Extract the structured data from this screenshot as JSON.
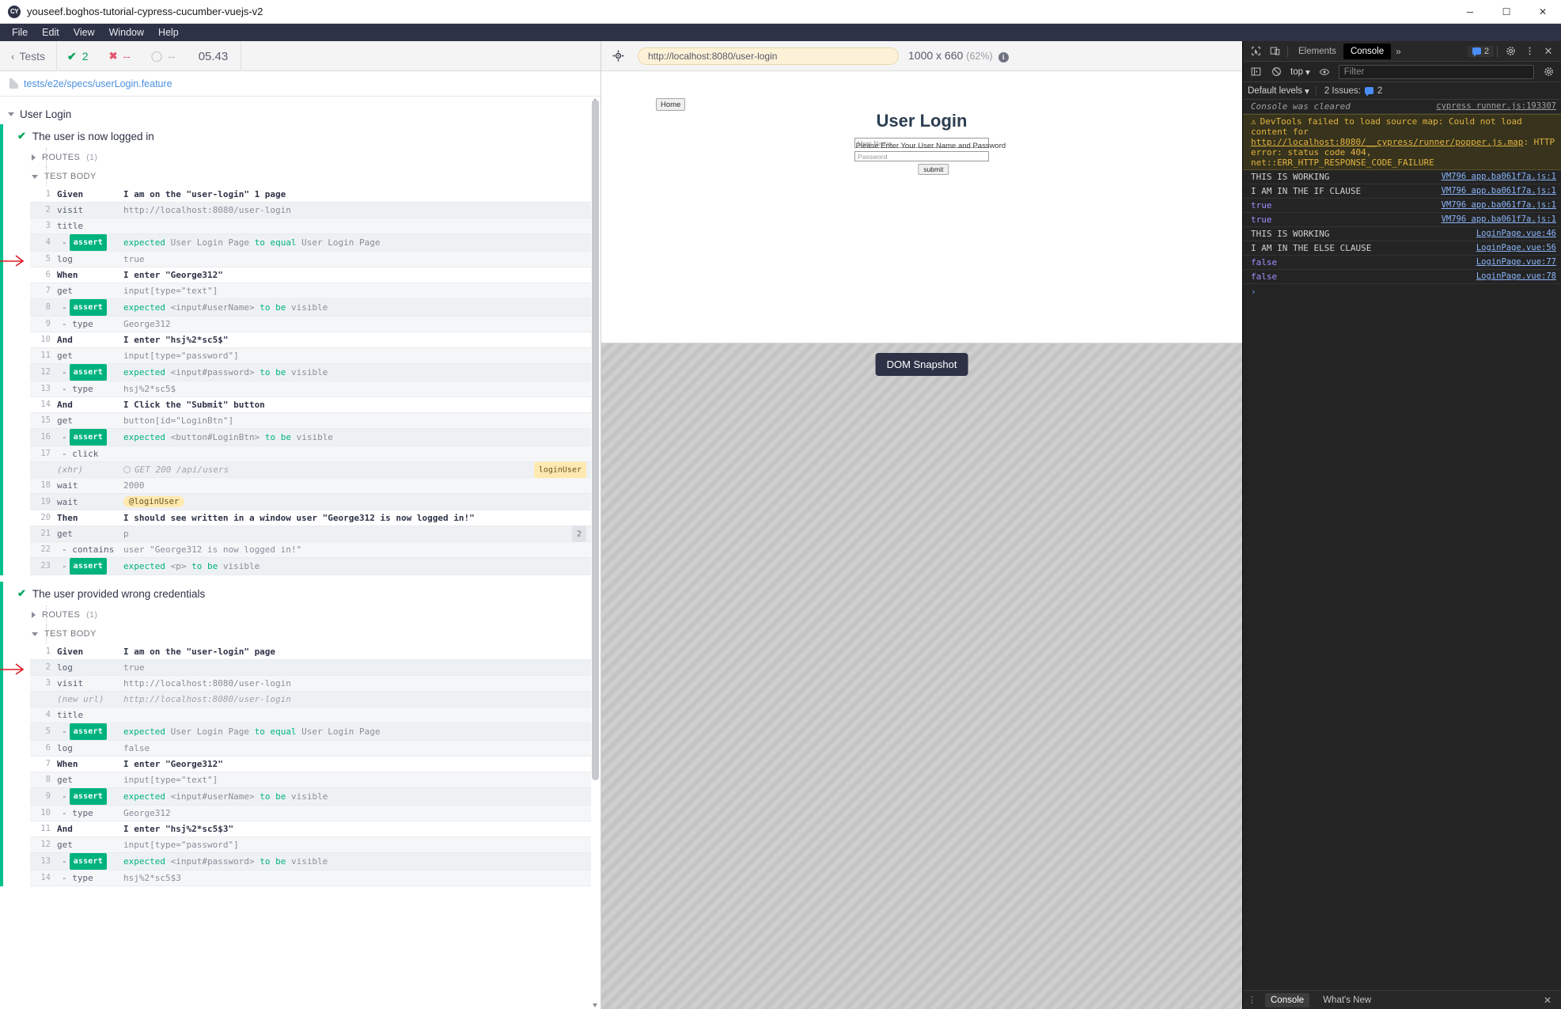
{
  "window": {
    "title": "youseef.boghos-tutorial-cypress-cucumber-vuejs-v2",
    "logo_text": "CY",
    "minimize": "─",
    "maximize": "☐",
    "close": "✕"
  },
  "menubar": {
    "items": [
      "File",
      "Edit",
      "View",
      "Window",
      "Help"
    ]
  },
  "reporter": {
    "back_label": "Tests",
    "back_chevron": "‹",
    "stats": {
      "passed_icon": "✔",
      "passed": "2",
      "failed_icon": "✖",
      "failed": "--",
      "pending_icon": "◯",
      "pending": "--"
    },
    "timer": "05.43",
    "restart_icon": "reload-icon",
    "spec_path": "tests/e2e/specs/userLogin.feature",
    "suite_title": "User Login",
    "tests": [
      {
        "name": "The user is now logged in",
        "routes_label": "ROUTES",
        "routes_count": "(1)",
        "test_body_label": "TEST BODY",
        "commands": [
          {
            "num": "1",
            "method": "Given",
            "message": "I am on the \"user-login\" 1 page",
            "type": "gherkin"
          },
          {
            "num": "2",
            "method": "visit",
            "message": "http://localhost:8080/user-login",
            "type": "normal"
          },
          {
            "num": "3",
            "method": "title",
            "message": "",
            "type": "normal"
          },
          {
            "num": "4",
            "method": "assert",
            "message": "expected User Login Page to equal User Login Page",
            "type": "assert",
            "child": true
          },
          {
            "num": "5",
            "method": "log",
            "message": "true",
            "type": "normal",
            "arrow": true
          },
          {
            "num": "6",
            "method": "When",
            "message": "I enter \"George312\"",
            "type": "gherkin"
          },
          {
            "num": "7",
            "method": "get",
            "message": "input[type=\"text\"]",
            "type": "normal"
          },
          {
            "num": "8",
            "method": "assert",
            "message": "expected <input#userName> to be visible",
            "type": "assert",
            "child": true
          },
          {
            "num": "9",
            "method": "type",
            "message": "George312",
            "type": "normal",
            "child": true
          },
          {
            "num": "10",
            "method": "And",
            "message": "I enter \"hsj%2*sc5$\"",
            "type": "gherkin"
          },
          {
            "num": "11",
            "method": "get",
            "message": "input[type=\"password\"]",
            "type": "normal"
          },
          {
            "num": "12",
            "method": "assert",
            "message": "expected <input#password> to be visible",
            "type": "assert",
            "child": true
          },
          {
            "num": "13",
            "method": "type",
            "message": "hsj%2*sc5$",
            "type": "normal",
            "child": true
          },
          {
            "num": "14",
            "method": "And",
            "message": "I Click the \"Submit\" button",
            "type": "gherkin"
          },
          {
            "num": "15",
            "method": "get",
            "message": "button[id=\"LoginBtn\"]",
            "type": "normal"
          },
          {
            "num": "16",
            "method": "assert",
            "message": "expected <button#LoginBtn> to be visible",
            "type": "assert",
            "child": true
          },
          {
            "num": "17",
            "method": "click",
            "message": "",
            "type": "normal",
            "child": true
          },
          {
            "num": "",
            "method": "(xhr)",
            "message": "GET 200 /api/users",
            "type": "xhr",
            "badge": "loginUser"
          },
          {
            "num": "18",
            "method": "wait",
            "message": "2000",
            "type": "normal"
          },
          {
            "num": "19",
            "method": "wait",
            "message": "@loginUser",
            "type": "alias"
          },
          {
            "num": "20",
            "method": "Then",
            "message": "I should see written in a window user \"George312 is now logged in!\"",
            "type": "gherkin"
          },
          {
            "num": "21",
            "method": "get",
            "message": "p",
            "type": "normal",
            "count": "2"
          },
          {
            "num": "22",
            "method": "contains",
            "message": "user \"George312 is now logged in!\"",
            "type": "normal",
            "child": true
          },
          {
            "num": "23",
            "method": "assert",
            "message": "expected <p> to be visible",
            "type": "assert",
            "child": true
          }
        ]
      },
      {
        "name": "The user provided wrong credentials",
        "routes_label": "ROUTES",
        "routes_count": "(1)",
        "test_body_label": "TEST BODY",
        "commands": [
          {
            "num": "1",
            "method": "Given",
            "message": "I am on the \"user-login\" page",
            "type": "gherkin"
          },
          {
            "num": "2",
            "method": "log",
            "message": "true",
            "type": "normal",
            "arrow": true
          },
          {
            "num": "3",
            "method": "visit",
            "message": "http://localhost:8080/user-login",
            "type": "normal"
          },
          {
            "num": "",
            "method": "(new url)",
            "message": "http://localhost:8080/user-login",
            "type": "newurl"
          },
          {
            "num": "4",
            "method": "title",
            "message": "",
            "type": "normal"
          },
          {
            "num": "5",
            "method": "assert",
            "message": "expected User Login Page to equal User Login Page",
            "type": "assert",
            "child": true
          },
          {
            "num": "6",
            "method": "log",
            "message": "false",
            "type": "normal"
          },
          {
            "num": "7",
            "method": "When",
            "message": "I enter \"George312\"",
            "type": "gherkin"
          },
          {
            "num": "8",
            "method": "get",
            "message": "input[type=\"text\"]",
            "type": "normal"
          },
          {
            "num": "9",
            "method": "assert",
            "message": "expected <input#userName> to be visible",
            "type": "assert",
            "child": true
          },
          {
            "num": "10",
            "method": "type",
            "message": "George312",
            "type": "normal",
            "child": true
          },
          {
            "num": "11",
            "method": "And",
            "message": "I enter \"hsj%2*sc5$3\"",
            "type": "gherkin"
          },
          {
            "num": "12",
            "method": "get",
            "message": "input[type=\"password\"]",
            "type": "normal"
          },
          {
            "num": "13",
            "method": "assert",
            "message": "expected <input#password> to be visible",
            "type": "assert",
            "child": true
          },
          {
            "num": "14",
            "method": "type",
            "message": "hsj%2*sc5$3",
            "type": "normal",
            "child": true
          }
        ]
      }
    ]
  },
  "aut": {
    "selector_icon": "selector-playground-icon",
    "url": "http://localhost:8080/user-login",
    "viewport_size": "1000 x 660",
    "scale": "(62%)",
    "info_icon": "i",
    "snapshot_label": "DOM Snapshot",
    "page": {
      "home_button": "Home",
      "title": "User Login",
      "username_placeholder": "User Name",
      "password_placeholder": "Password",
      "hint": "Please Enter Your User Name and Password",
      "submit_label": "submit"
    }
  },
  "devtools": {
    "tabs": [
      "Elements",
      "Console"
    ],
    "active_tab": "Console",
    "more_icon": "»",
    "issues_badge_count": "2",
    "settings_icon": "gear-icon",
    "kebab_icon": "kebab-menu-icon",
    "close_icon": "✕",
    "inspect_icon": "inspect-element-icon",
    "device_icon": "device-toolbar-icon",
    "sidebar_icon": "console-sidebar-icon",
    "clear_icon": "clear-console-icon",
    "context": "top",
    "eye_icon": "live-expression-icon",
    "filter_placeholder": "Filter",
    "levels_label": "Default levels",
    "issues_label": "2 Issues:",
    "issues_count": "2",
    "messages": [
      {
        "text": "Console was cleared",
        "source": "cypress runner.js:193307",
        "kind": "cleared"
      },
      {
        "text": "DevTools failed to load source map: Could not load content for http://localhost:8080/__cypress/runner/popper.js.map: HTTP error: status code 404, net::ERR_HTTP_RESPONSE_CODE_FAILURE",
        "source": "",
        "kind": "warn"
      },
      {
        "text": "THIS IS WORKING",
        "source": "VM796 app.ba061f7a.js:1",
        "kind": "log"
      },
      {
        "text": "I AM IN THE IF CLAUSE",
        "source": "VM796 app.ba061f7a.js:1",
        "kind": "log"
      },
      {
        "text": "true",
        "source": "VM796 app.ba061f7a.js:1",
        "kind": "bool"
      },
      {
        "text": "true",
        "source": "VM796 app.ba061f7a.js:1",
        "kind": "bool"
      },
      {
        "text": "THIS IS WORKING",
        "source": "LoginPage.vue:46",
        "kind": "log"
      },
      {
        "text": "I AM IN THE ELSE CLAUSE",
        "source": "LoginPage.vue:56",
        "kind": "log"
      },
      {
        "text": "false",
        "source": "LoginPage.vue:77",
        "kind": "bool"
      },
      {
        "text": "false",
        "source": "LoginPage.vue:78",
        "kind": "bool"
      }
    ],
    "prompt_symbol": "›",
    "drawer": {
      "tabs": [
        "Console",
        "What's New"
      ],
      "active": "Console",
      "close_icon": "✕"
    }
  }
}
